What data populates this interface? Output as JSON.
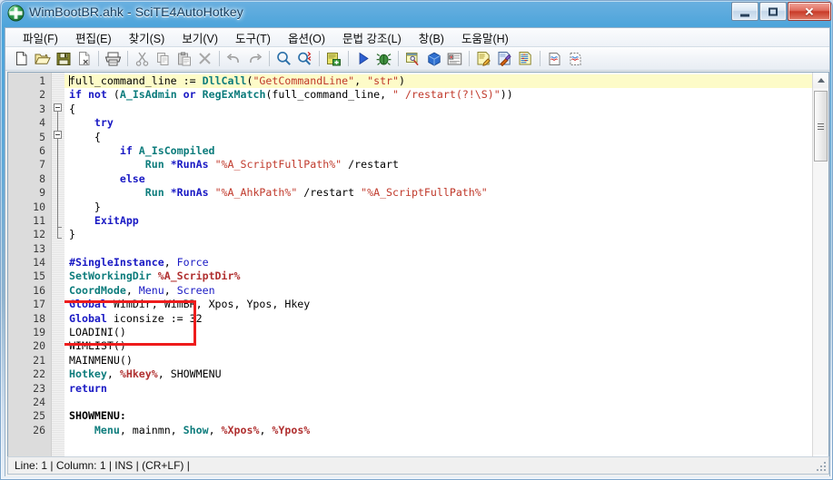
{
  "window": {
    "title": "WimBootBR.ahk - SciTE4AutoHotkey",
    "icon": "autohotkey-icon",
    "minimize_label": "",
    "maximize_label": "",
    "close_label": "✕"
  },
  "menubar": {
    "items": [
      {
        "label": "파일(F)",
        "name": "menu-file"
      },
      {
        "label": "편집(E)",
        "name": "menu-edit"
      },
      {
        "label": "찾기(S)",
        "name": "menu-search"
      },
      {
        "label": "보기(V)",
        "name": "menu-view"
      },
      {
        "label": "도구(T)",
        "name": "menu-tools"
      },
      {
        "label": "옵션(O)",
        "name": "menu-options"
      },
      {
        "label": "문법 강조(L)",
        "name": "menu-language"
      },
      {
        "label": "창(B)",
        "name": "menu-buffers"
      },
      {
        "label": "도움말(H)",
        "name": "menu-help"
      }
    ]
  },
  "toolbar": {
    "icons": [
      "new-file-icon",
      "open-folder-icon",
      "save-icon",
      "close-file-icon",
      "print-icon",
      "cut-icon",
      "copy-icon",
      "paste-icon",
      "delete-icon",
      "undo-icon",
      "redo-icon",
      "find-icon",
      "replace-icon",
      "compile-icon",
      "run-icon",
      "debug-icon",
      "window-spy-icon",
      "package-icon",
      "properties-icon",
      "edit-script-icon",
      "edit-with-tool-icon",
      "list-script-icon",
      "doc-wavy-icon",
      "doc-wavy-dotted-icon"
    ]
  },
  "editor": {
    "line_numbers": [
      1,
      2,
      3,
      4,
      5,
      6,
      7,
      8,
      9,
      10,
      11,
      12,
      13,
      14,
      15,
      16,
      17,
      18,
      19,
      20,
      21,
      22,
      23,
      24,
      25,
      26
    ],
    "current_line": 1,
    "lines": [
      "full_command_line := DllCall(\"GetCommandLine\", \"str\")",
      "if not (A_IsAdmin or RegExMatch(full_command_line, \" /restart(?!\\S)\"))",
      "{",
      "    try",
      "    {",
      "        if A_IsCompiled",
      "            Run *RunAs \"%A_ScriptFullPath%\" /restart",
      "        else",
      "            Run *RunAs \"%A_AhkPath%\" /restart \"%A_ScriptFullPath%\"",
      "    }",
      "    ExitApp",
      "}",
      "",
      "#SingleInstance, Force",
      "SetWorkingDir %A_ScriptDir%",
      "CoordMode, Menu, Screen",
      "Global WimDir, WimBR, Xpos, Ypos, Hkey",
      "Global iconsize := 32",
      "LOADINI()",
      "WIMLIST()",
      "MAINMENU()",
      "Hotkey, %Hkey%, SHOWMENU",
      "return",
      "",
      "SHOWMENU:",
      "    Menu, mainmn, Show, %Xpos%, %Ypos%"
    ],
    "annotation": {
      "name": "red-highlight-box",
      "color": "#ee1c1c",
      "covers_lines": "17-19"
    }
  },
  "statusbar": {
    "text": "Line: 1 | Column: 1 | INS | (CR+LF) |"
  },
  "colors": {
    "keyword": "#1919c4",
    "function": "#0d7c7c",
    "string": "#c0392b",
    "variable": "#b03030",
    "current_line_bg": "#fdfbc8",
    "gutter_bg": "#dcdcdc",
    "annotation": "#ee1c1c"
  }
}
